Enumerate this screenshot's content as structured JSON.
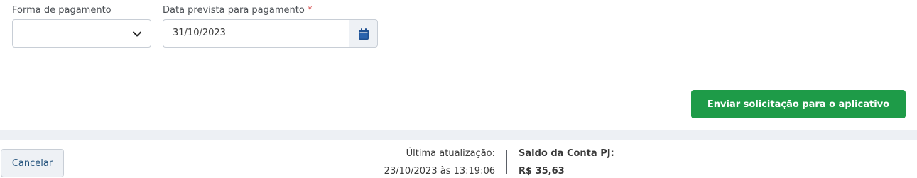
{
  "form": {
    "payment_method": {
      "label": "Forma de pagamento",
      "value": ""
    },
    "payment_date": {
      "label": "Data prevista para pagamento",
      "required_marker": "*",
      "value": "31/10/2023"
    },
    "submit_label": "Enviar solicitação para o aplicativo"
  },
  "footer": {
    "cancel_label": "Cancelar",
    "last_update_label": "Última atualização:",
    "last_update_value": "23/10/2023 às 13:19:06",
    "balance_label": "Saldo da Conta PJ:",
    "balance_value": "R$ 35,63"
  },
  "colors": {
    "primary_green": "#1e9b48",
    "calendar_icon": "#1d4f91",
    "required": "#d23c3c"
  },
  "icons": {
    "select_chevron": "chevron-down-icon",
    "date_picker": "calendar-icon"
  }
}
